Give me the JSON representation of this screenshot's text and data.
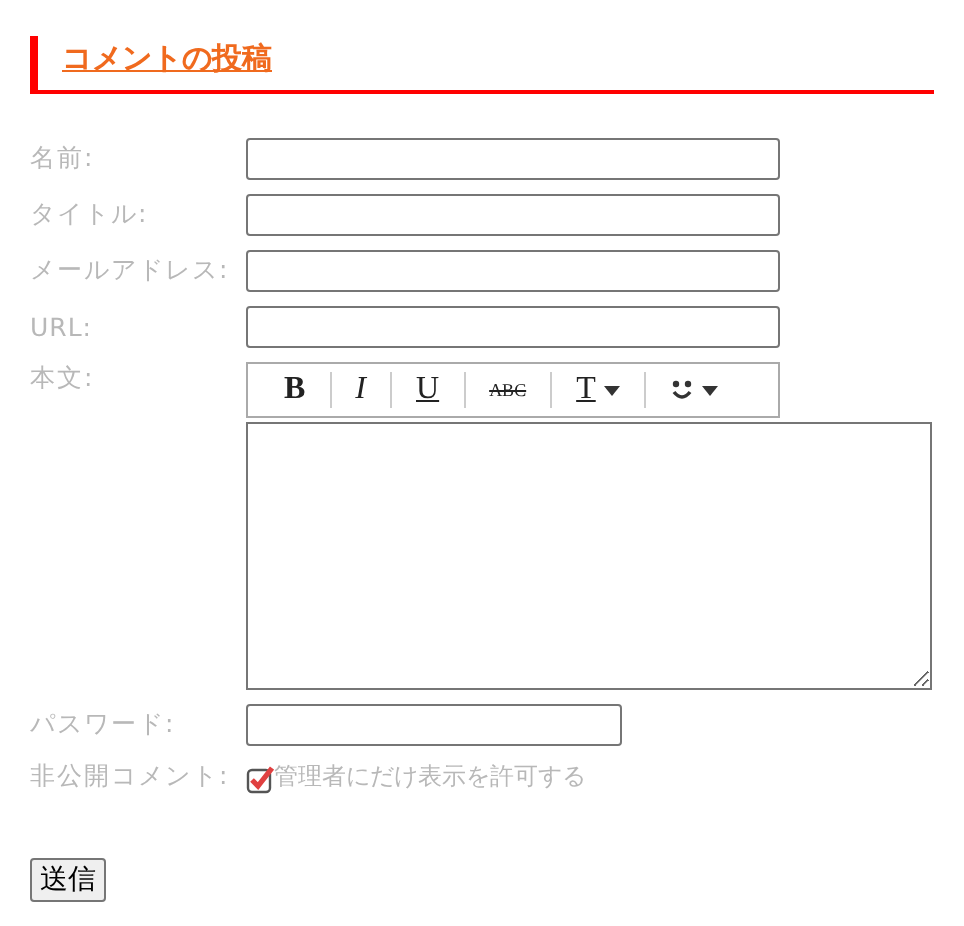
{
  "heading": "コメントの投稿",
  "fields": [
    {
      "label": "名前:",
      "kind": "text"
    },
    {
      "label": "タイトル:",
      "kind": "text"
    },
    {
      "label": "メールアドレス:",
      "kind": "text"
    },
    {
      "label": "URL:",
      "kind": "text"
    }
  ],
  "body": {
    "label": "本文:",
    "toolbar": [
      {
        "kind": "bold",
        "text": "B"
      },
      {
        "kind": "italic",
        "text": "I"
      },
      {
        "kind": "underline",
        "text": "U"
      },
      {
        "kind": "strike",
        "text": "ABC"
      },
      {
        "kind": "color",
        "text": "T"
      },
      {
        "kind": "emoji"
      }
    ]
  },
  "password": {
    "label": "パスワード:"
  },
  "private": {
    "label": "非公開コメント:",
    "option": "管理者にだけ表示を許可する",
    "checked": true
  },
  "submit": "送信"
}
